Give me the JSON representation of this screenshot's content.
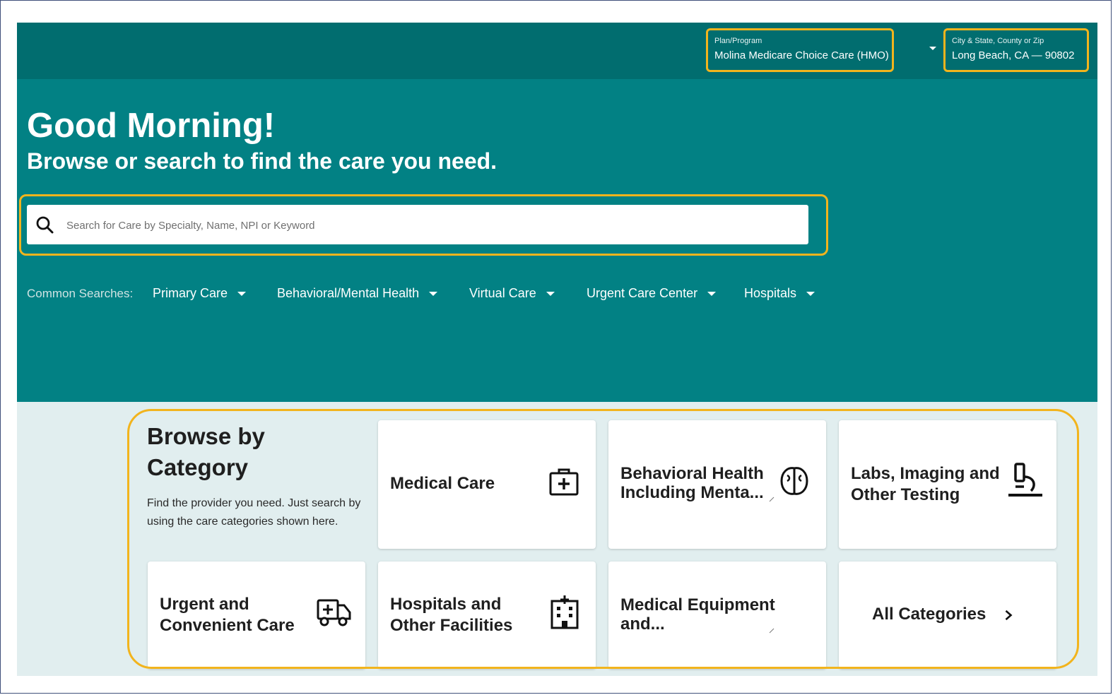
{
  "header": {
    "plan_label": "Plan/Program",
    "plan_value": "Molina Medicare Choice Care (HMO)",
    "location_label": "City & State, County or Zip",
    "location_value": "Long Beach, CA — 90802"
  },
  "hero": {
    "greeting": "Good Morning!",
    "subtitle": "Browse or search to find the care you need."
  },
  "search": {
    "placeholder": "Search for Care by Specialty, Name, NPI or Keyword",
    "value": ""
  },
  "common_searches": {
    "label": "Common Searches:",
    "items": [
      "Primary Care",
      "Behavioral/Mental Health",
      "Virtual Care",
      "Urgent Care Center",
      "Hospitals"
    ]
  },
  "browse": {
    "title": "Browse by Category",
    "description": "Find the provider you need. Just search by using the care categories shown here.",
    "categories": [
      {
        "label": "Medical Care",
        "icon": "medical-kit-icon"
      },
      {
        "label": "Behavioral Health Including Menta...",
        "icon": "brain-icon"
      },
      {
        "label": "Labs, Imaging and Other Testing",
        "icon": "microscope-icon"
      },
      {
        "label": "Urgent and Convenient Care",
        "icon": "ambulance-icon"
      },
      {
        "label": "Hospitals and Other Facilities",
        "icon": "hospital-building-icon"
      },
      {
        "label": "Medical Equipment and...",
        "icon": ""
      },
      {
        "label": "All Categories",
        "icon": "chevron-right-icon"
      }
    ]
  },
  "colors": {
    "header_bg": "#016d6f",
    "hero_bg": "#028184",
    "lower_bg": "#e1eeef",
    "highlight": "#f2b41d"
  }
}
